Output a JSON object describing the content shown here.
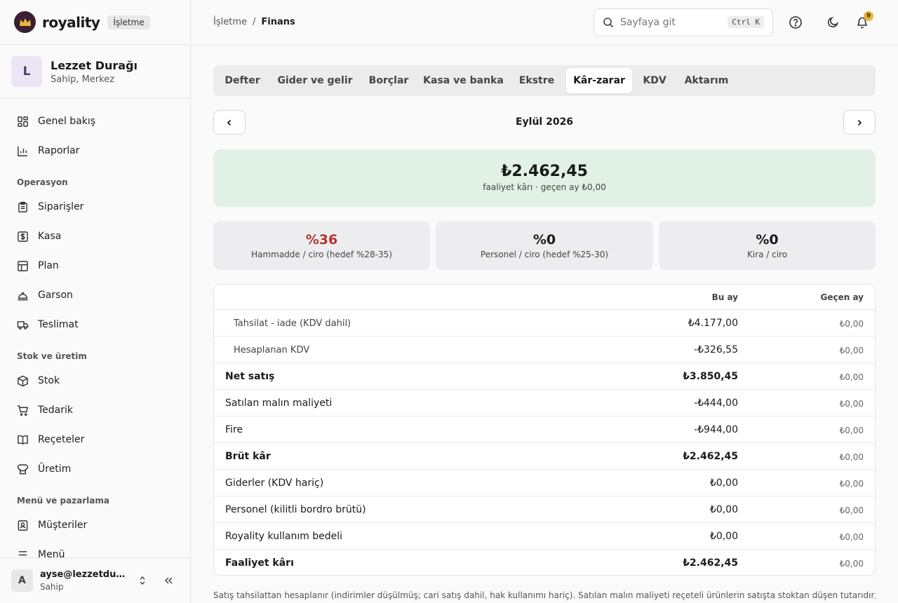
{
  "brand": {
    "name": "royality",
    "workspace_label": "İşletme"
  },
  "business": {
    "initial": "L",
    "name": "Lezzet Durağı",
    "role": "Sahip, Merkez"
  },
  "sidebar": {
    "top_items": [
      {
        "label": "Genel bakış",
        "icon": "grid-icon"
      },
      {
        "label": "Raporlar",
        "icon": "bar-chart-icon"
      }
    ],
    "sections": [
      {
        "title": "Operasyon",
        "items": [
          {
            "label": "Siparişler",
            "icon": "clipboard-icon"
          },
          {
            "label": "Kasa",
            "icon": "cash-icon"
          },
          {
            "label": "Plan",
            "icon": "layout-icon"
          },
          {
            "label": "Garson",
            "icon": "cloche-icon"
          },
          {
            "label": "Teslimat",
            "icon": "truck-icon"
          }
        ]
      },
      {
        "title": "Stok ve üretim",
        "items": [
          {
            "label": "Stok",
            "icon": "package-icon"
          },
          {
            "label": "Tedarik",
            "icon": "cart-icon"
          },
          {
            "label": "Reçeteler",
            "icon": "book-icon"
          },
          {
            "label": "Üretim",
            "icon": "chef-hat-icon"
          }
        ]
      },
      {
        "title": "Menü ve pazarlama",
        "items": [
          {
            "label": "Müşteriler",
            "icon": "contact-icon"
          },
          {
            "label": "Menü",
            "icon": "menu-icon"
          }
        ]
      }
    ]
  },
  "user": {
    "initial": "A",
    "email": "ayse@lezzetduragi.com",
    "role": "Sahip"
  },
  "header": {
    "breadcrumb": [
      "İşletme",
      "Finans"
    ],
    "search_placeholder": "Sayfaya git",
    "search_shortcut": "Ctrl K",
    "notification_count": "9"
  },
  "tabs": [
    {
      "label": "Defter"
    },
    {
      "label": "Gider ve gelir"
    },
    {
      "label": "Borçlar"
    },
    {
      "label": "Kasa ve banka"
    },
    {
      "label": "Ekstre"
    },
    {
      "label": "Kâr-zarar",
      "active": true
    },
    {
      "label": "KDV"
    },
    {
      "label": "Aktarım"
    }
  ],
  "period": "Eylül 2026",
  "hero": {
    "value": "₺2.462,45",
    "caption": "faaliyet kârı · geçen ay ₺0,00",
    "color": "#e1f1e6"
  },
  "kpis": [
    {
      "value": "%36",
      "label": "Hammadde / ciro (hedef %28-35)",
      "status": "over-target",
      "color": "#b3322f"
    },
    {
      "value": "%0",
      "label": "Personel / ciro (hedef %25-30)"
    },
    {
      "value": "%0",
      "label": "Kira / ciro"
    }
  ],
  "table": {
    "columns": {
      "current": "Bu ay",
      "previous": "Geçen ay"
    },
    "rows": [
      {
        "label": "Tahsilat - iade (KDV dahil)",
        "current": "₺4.177,00",
        "previous": "₺0,00",
        "style": "sub"
      },
      {
        "label": "Hesaplanan KDV",
        "current": "-₺326,55",
        "previous": "₺0,00",
        "style": "sub"
      },
      {
        "label": "Net satış",
        "current": "₺3.850,45",
        "previous": "₺0,00",
        "style": "bold"
      },
      {
        "label": "Satılan malın maliyeti",
        "current": "-₺444,00",
        "previous": "₺0,00",
        "style": "normal"
      },
      {
        "label": "Fire",
        "current": "-₺944,00",
        "previous": "₺0,00",
        "style": "normal"
      },
      {
        "label": "Brüt kâr",
        "current": "₺2.462,45",
        "previous": "₺0,00",
        "style": "bold"
      },
      {
        "label": "Giderler (KDV hariç)",
        "current": "₺0,00",
        "previous": "₺0,00",
        "style": "normal"
      },
      {
        "label": "Personel (kilitli bordro brütü)",
        "current": "₺0,00",
        "previous": "₺0,00",
        "style": "normal"
      },
      {
        "label": "Royality kullanım bedeli",
        "current": "₺0,00",
        "previous": "₺0,00",
        "style": "normal"
      },
      {
        "label": "Faaliyet kârı",
        "current": "₺2.462,45",
        "previous": "₺0,00",
        "style": "bold"
      }
    ]
  },
  "footnote": "Satış tahsilattan hesaplanır (indirimler düşülmüş; cari satış dahil, hak kullanımı hariç). Satılan malın maliyeti reçeteli ürünlerin satışta stoktan düşen tutarıdır;"
}
